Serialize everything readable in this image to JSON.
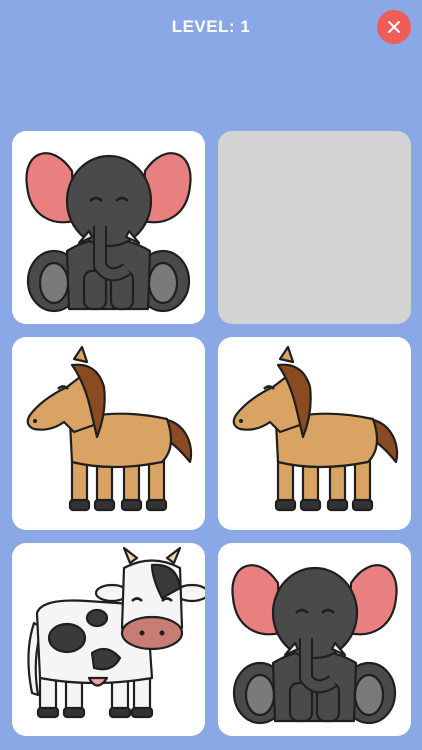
{
  "header": {
    "level_title": "LEVEL: 1",
    "close_icon": "close-icon",
    "close_color": "#ee5d58"
  },
  "board": {
    "columns": 2,
    "rows": 3,
    "cards": [
      {
        "state": "revealed",
        "animal": "elephant"
      },
      {
        "state": "empty",
        "animal": ""
      },
      {
        "state": "revealed",
        "animal": "horse"
      },
      {
        "state": "revealed",
        "animal": "horse"
      },
      {
        "state": "revealed",
        "animal": "cow"
      },
      {
        "state": "revealed",
        "animal": "elephant"
      }
    ]
  },
  "colors": {
    "background": "#8aa7e6",
    "card": "#ffffff",
    "empty_card": "#d3d3d3"
  }
}
